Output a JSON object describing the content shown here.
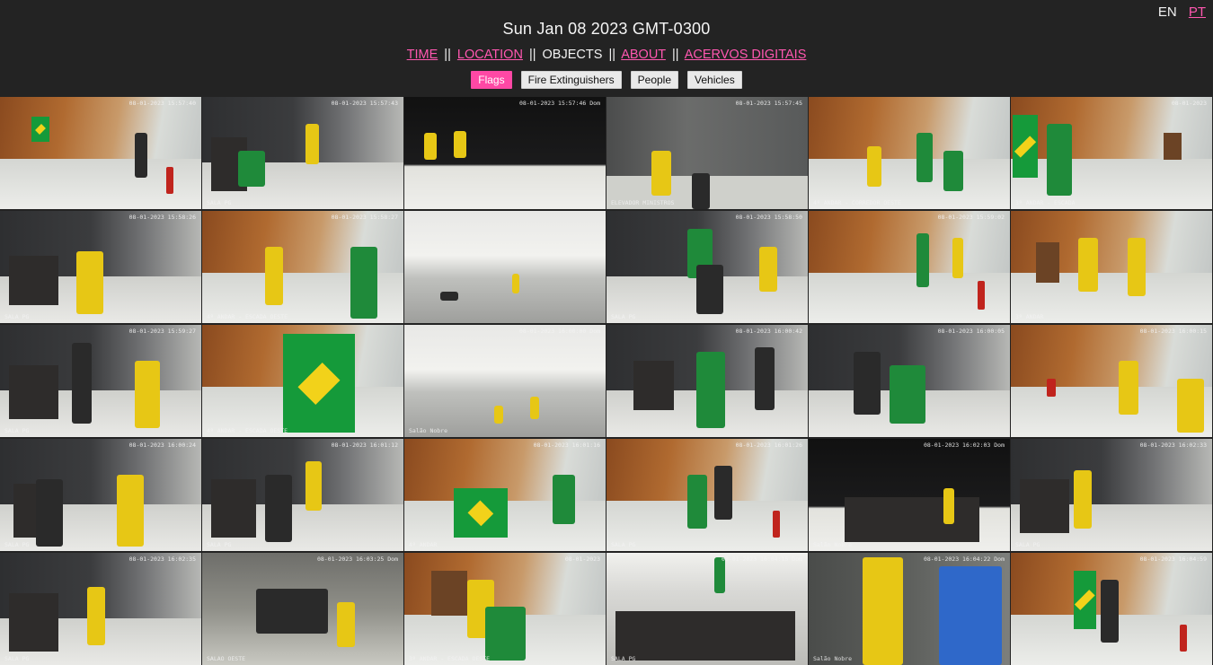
{
  "language": {
    "options": [
      "EN",
      "PT"
    ],
    "active": "EN"
  },
  "header": {
    "title": "Sun Jan 08 2023 GMT-0300"
  },
  "nav": {
    "items": [
      {
        "label": "TIME",
        "link": true
      },
      {
        "label": "LOCATION",
        "link": true
      },
      {
        "label": "OBJECTS",
        "link": false
      },
      {
        "label": "ABOUT",
        "link": true
      },
      {
        "label": "ACERVOS DIGITAIS",
        "link": true
      }
    ],
    "separator": "||"
  },
  "filters": {
    "options": [
      "Flags",
      "Fire Extinguishers",
      "People",
      "Vehicles"
    ],
    "selected": "Flags"
  },
  "colors": {
    "accent": "#ff48a5",
    "link": "#ff57b0",
    "background": "#232323"
  },
  "grid": {
    "tiles": [
      {
        "stamp": "08-01-2023 15:57:40",
        "label": "",
        "scene": "wood"
      },
      {
        "stamp": "08-01-2023 15:57:43",
        "label": "SALA PG",
        "scene": "dark"
      },
      {
        "stamp": "08-01-2023 15:57:46 Dom",
        "label": "",
        "scene": "black"
      },
      {
        "stamp": "08-01-2023 15:57:45",
        "label": "ELEVADOR MINISTROS",
        "scene": "elev"
      },
      {
        "stamp": "",
        "label": "4º ANDAR - CORREDOR OESTE",
        "scene": "wood"
      },
      {
        "stamp": "08-01-2023",
        "label": "3º ANDAR - ESCADA",
        "scene": "wood"
      },
      {
        "stamp": "08-01-2023 15:58:26",
        "label": "SALA PG",
        "scene": "dark"
      },
      {
        "stamp": "08-01-2023 15:58:27",
        "label": "4º ANDAR - ESCADA OESTE",
        "scene": "wood"
      },
      {
        "stamp": "",
        "label": "",
        "scene": "hall"
      },
      {
        "stamp": "08-01-2023 15:58:50",
        "label": "SALA PG",
        "scene": "dark"
      },
      {
        "stamp": "08-01-2023 15:59:02",
        "label": "",
        "scene": "wood"
      },
      {
        "stamp": "",
        "label": "3º ANDAR",
        "scene": "wood"
      },
      {
        "stamp": "08-01-2023 15:59:27",
        "label": "SALA PG",
        "scene": "dark"
      },
      {
        "stamp": "",
        "label": "4º ANDAR - ESCADA OESTE",
        "scene": "wood"
      },
      {
        "stamp": "08-01-2023 16:00:00 Dom",
        "label": "Salão Nobre",
        "scene": "hall"
      },
      {
        "stamp": "08-01-2023 16:00:42",
        "label": "",
        "scene": "dark"
      },
      {
        "stamp": "08-01-2023 16:00:05",
        "label": "",
        "scene": "dark"
      },
      {
        "stamp": "08-01-2023 16:00:15",
        "label": "",
        "scene": "wood"
      },
      {
        "stamp": "08-01-2023 16:00:24",
        "label": "SALA PG",
        "scene": "dark"
      },
      {
        "stamp": "08-01-2023 16:01:12",
        "label": "SALA PG",
        "scene": "dark"
      },
      {
        "stamp": "08-01-2023 16:01:16",
        "label": "4º ANDAR",
        "scene": "wood"
      },
      {
        "stamp": "08-01-2023 16:01:26",
        "label": "SALA PG",
        "scene": "wood"
      },
      {
        "stamp": "08-01-2023 16:02:03 Dom",
        "label": "Salão Nobre",
        "scene": "black"
      },
      {
        "stamp": "08-01-2023 16:02:33",
        "label": "SALA PG",
        "scene": "dark"
      },
      {
        "stamp": "08-01-2023 16:02:35",
        "label": "SALA PG",
        "scene": "dark"
      },
      {
        "stamp": "08-01-2023 16:03:25 Dom",
        "label": "SALAO OESTE",
        "scene": "glass"
      },
      {
        "stamp": "08-01-2023",
        "label": "3º ANDAR - ESCADA OESTE",
        "scene": "wood"
      },
      {
        "stamp": "08-01-2023 16:04:15 Dom",
        "label": "SALA PG",
        "scene": "chairs"
      },
      {
        "stamp": "08-01-2023 16:04:22 Dom",
        "label": "Salão Nobre",
        "scene": "blue"
      },
      {
        "stamp": "08-01-2023 16:04:59",
        "label": "",
        "scene": "wood"
      }
    ]
  }
}
